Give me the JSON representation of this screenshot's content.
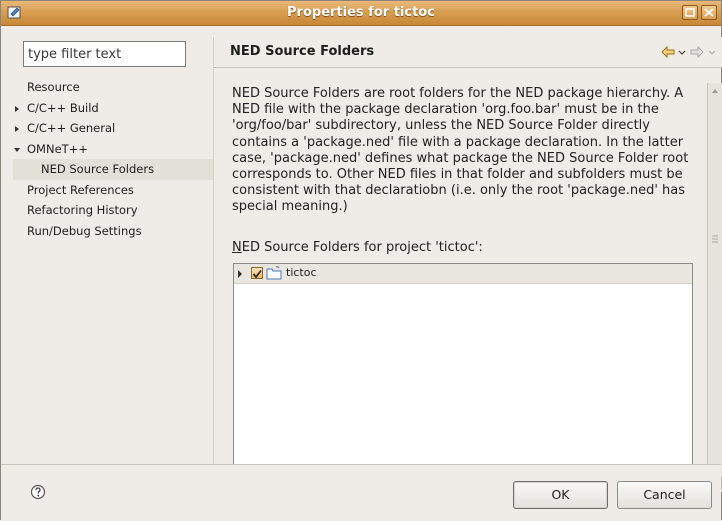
{
  "window": {
    "title": "Properties for tictoc"
  },
  "filter": {
    "placeholder": "type filter text",
    "value": "type filter text"
  },
  "sidebar": {
    "items": [
      {
        "label": "Resource",
        "arrow": "none"
      },
      {
        "label": "C/C++ Build",
        "arrow": "collapsed"
      },
      {
        "label": "C/C++ General",
        "arrow": "collapsed"
      },
      {
        "label": "OMNeT++",
        "arrow": "expanded"
      },
      {
        "label": "NED Source Folders",
        "arrow": "none",
        "child": true,
        "selected": true
      },
      {
        "label": "Project References",
        "arrow": "none"
      },
      {
        "label": "Refactoring History",
        "arrow": "none"
      },
      {
        "label": "Run/Debug Settings",
        "arrow": "none"
      }
    ]
  },
  "page": {
    "title": "NED Source Folders",
    "description": "NED Source Folders are root folders for the NED package hierarchy. A NED file with the package declaration 'org.foo.bar' must be in the 'org/foo/bar' subdirectory, unless the NED Source Folder directly contains a 'package.ned' file with a package declaration. In the latter case, 'package.ned' defines what package the NED Source Folder root corresponds to. Other NED files in that folder and subfolders must be consistent with that declaratiobn (i.e. only the root 'package.ned' has special meaning.)",
    "list_label_mnemonic": "N",
    "list_label_rest": "ED Source Folders for project 'tictoc':",
    "folders": [
      {
        "label": "tictoc",
        "checked": true
      }
    ]
  },
  "buttons": {
    "ok": "OK",
    "cancel": "Cancel"
  },
  "colors": {
    "titlebar": "#d59a4a",
    "selection": "#e3dfd9",
    "accent": "#f2b86c"
  }
}
